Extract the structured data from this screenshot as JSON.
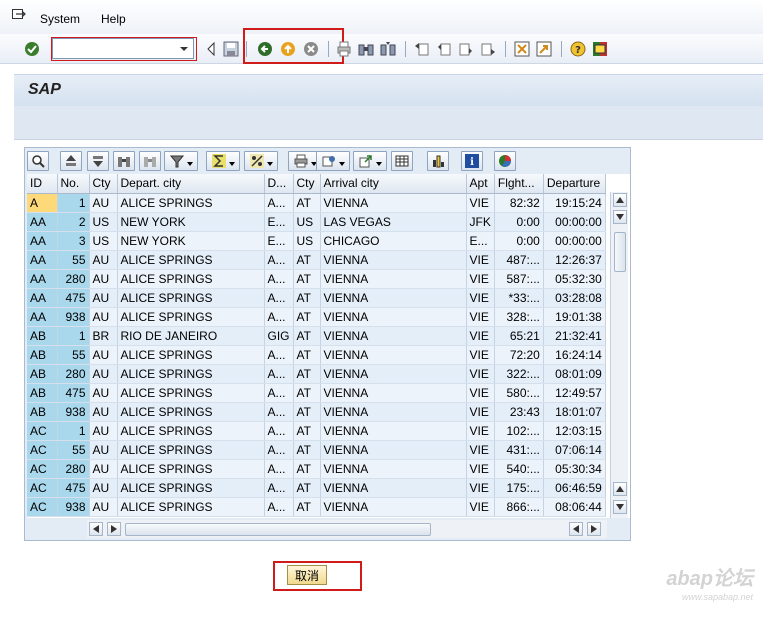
{
  "menu": {
    "system": "System",
    "help": "Help"
  },
  "command_field": {
    "value": ""
  },
  "title": "SAP",
  "grid": {
    "columns": [
      "ID",
      "No.",
      "Cty",
      "Depart. city",
      "D...",
      "Cty",
      "Arrival city",
      "Apt",
      "Flght...",
      "Departure"
    ],
    "rows": [
      [
        "A",
        "1",
        "AU",
        "ALICE SPRINGS",
        "A...",
        "AT",
        "VIENNA",
        "VIE",
        "82:32",
        "19:15:24"
      ],
      [
        "AA",
        "2",
        "US",
        "NEW YORK",
        "E...",
        "US",
        "LAS VEGAS",
        "JFK",
        "0:00",
        "00:00:00"
      ],
      [
        "AA",
        "3",
        "US",
        "NEW YORK",
        "E...",
        "US",
        "CHICAGO",
        "E...",
        "0:00",
        "00:00:00"
      ],
      [
        "AA",
        "55",
        "AU",
        "ALICE SPRINGS",
        "A...",
        "AT",
        "VIENNA",
        "VIE",
        "487:...",
        "12:26:37"
      ],
      [
        "AA",
        "280",
        "AU",
        "ALICE SPRINGS",
        "A...",
        "AT",
        "VIENNA",
        "VIE",
        "587:...",
        "05:32:30"
      ],
      [
        "AA",
        "475",
        "AU",
        "ALICE SPRINGS",
        "A...",
        "AT",
        "VIENNA",
        "VIE",
        "*33:...",
        "03:28:08"
      ],
      [
        "AA",
        "938",
        "AU",
        "ALICE SPRINGS",
        "A...",
        "AT",
        "VIENNA",
        "VIE",
        "328:...",
        "19:01:38"
      ],
      [
        "AB",
        "1",
        "BR",
        "RIO DE JANEIRO",
        "GIG",
        "AT",
        "VIENNA",
        "VIE",
        "65:21",
        "21:32:41"
      ],
      [
        "AB",
        "55",
        "AU",
        "ALICE SPRINGS",
        "A...",
        "AT",
        "VIENNA",
        "VIE",
        "72:20",
        "16:24:14"
      ],
      [
        "AB",
        "280",
        "AU",
        "ALICE SPRINGS",
        "A...",
        "AT",
        "VIENNA",
        "VIE",
        "322:...",
        "08:01:09"
      ],
      [
        "AB",
        "475",
        "AU",
        "ALICE SPRINGS",
        "A...",
        "AT",
        "VIENNA",
        "VIE",
        "580:...",
        "12:49:57"
      ],
      [
        "AB",
        "938",
        "AU",
        "ALICE SPRINGS",
        "A...",
        "AT",
        "VIENNA",
        "VIE",
        "23:43",
        "18:01:07"
      ],
      [
        "AC",
        "1",
        "AU",
        "ALICE SPRINGS",
        "A...",
        "AT",
        "VIENNA",
        "VIE",
        "102:...",
        "12:03:15"
      ],
      [
        "AC",
        "55",
        "AU",
        "ALICE SPRINGS",
        "A...",
        "AT",
        "VIENNA",
        "VIE",
        "431:...",
        "07:06:14"
      ],
      [
        "AC",
        "280",
        "AU",
        "ALICE SPRINGS",
        "A...",
        "AT",
        "VIENNA",
        "VIE",
        "540:...",
        "05:30:34"
      ],
      [
        "AC",
        "475",
        "AU",
        "ALICE SPRINGS",
        "A...",
        "AT",
        "VIENNA",
        "VIE",
        "175:...",
        "06:46:59"
      ],
      [
        "AC",
        "938",
        "AU",
        "ALICE SPRINGS",
        "A...",
        "AT",
        "VIENNA",
        "VIE",
        "866:...",
        "08:06:44"
      ]
    ],
    "selected_row": 0
  },
  "cancel_button": "取消",
  "watermark": {
    "main": "abap论坛",
    "sub": "www.sapabap.net"
  },
  "colors": {
    "highlight_box": "#d11a1a",
    "key_column": "#a9d7ec",
    "selected_key": "#fed97a"
  }
}
